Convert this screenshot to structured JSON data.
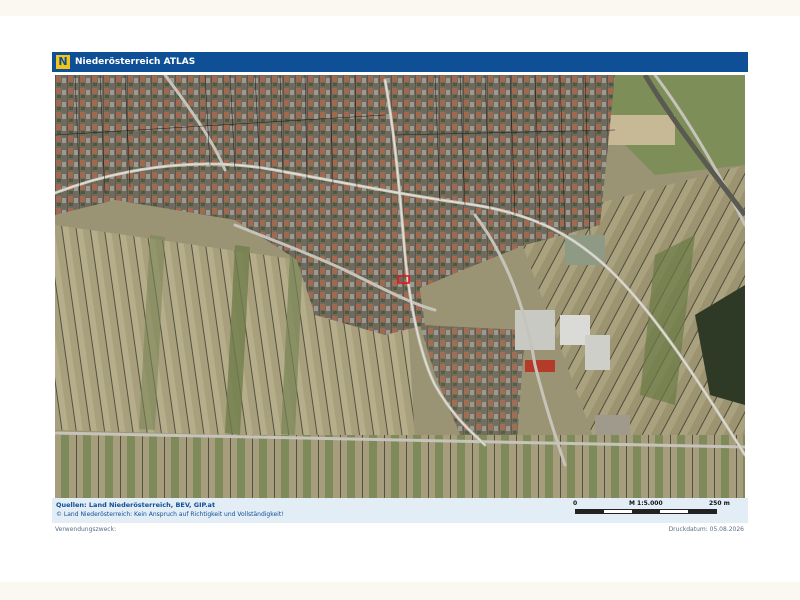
{
  "header": {
    "logo_letter": "N",
    "title": "Niederösterreich ATLAS",
    "accent_color": "#0f4f96",
    "logo_color": "#f3c518"
  },
  "map": {
    "type": "aerial-cadastral",
    "marker_color": "#e8141b"
  },
  "footer": {
    "sources": "Quellen: Land Niederösterreich, BEV, GIP.at",
    "disclaimer": "© Land Niederösterreich: Kein Anspruch auf Richtigkeit und Vollständigkeit!",
    "scale_start": "0",
    "scale_ratio": "M 1:5.000",
    "scale_end": "250 m"
  },
  "bottom": {
    "purpose_label": "Verwendungszweck:",
    "print_date": "Druckdatum: 05.08.2026"
  }
}
